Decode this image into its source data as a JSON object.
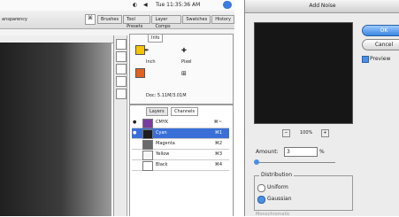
{
  "menubar": {
    "clock": "Tue 11:35:36 AM"
  },
  "optionbar": {
    "label": "ansparency",
    "palettes": [
      "Brushes",
      "Tool Presets",
      "Layer Comps",
      "Swatches",
      "History"
    ]
  },
  "navigator": {
    "tab": "Info",
    "rows": [
      "Inch",
      "Pixel"
    ],
    "size_text": "Doc: 5.11M/3.01M"
  },
  "layers": {
    "tabs": [
      "Layers",
      "Channels"
    ],
    "channels": [
      {
        "name": "CMYK",
        "key": "⌘~",
        "thumb": "#7a3ca0"
      },
      {
        "name": "Cyan",
        "key": "⌘1",
        "thumb": "#1e1e1e"
      },
      {
        "name": "Magenta",
        "key": "⌘2",
        "thumb": "#6a6a6a"
      },
      {
        "name": "Yellow",
        "key": "⌘3",
        "thumb": "#f6f6f6"
      },
      {
        "name": "Black",
        "key": "⌘4",
        "thumb": "#ffffff"
      }
    ]
  },
  "dialog": {
    "title": "Add Noise",
    "ok": "OK",
    "cancel": "Cancel",
    "preview_label": "Preview",
    "zoom": "100%",
    "amount_label": "Amount:",
    "amount_value": "3",
    "amount_unit": "%",
    "distribution_label": "Distribution",
    "uniform": "Uniform",
    "gaussian": "Gaussian",
    "monochromatic": "Monochromatic"
  }
}
